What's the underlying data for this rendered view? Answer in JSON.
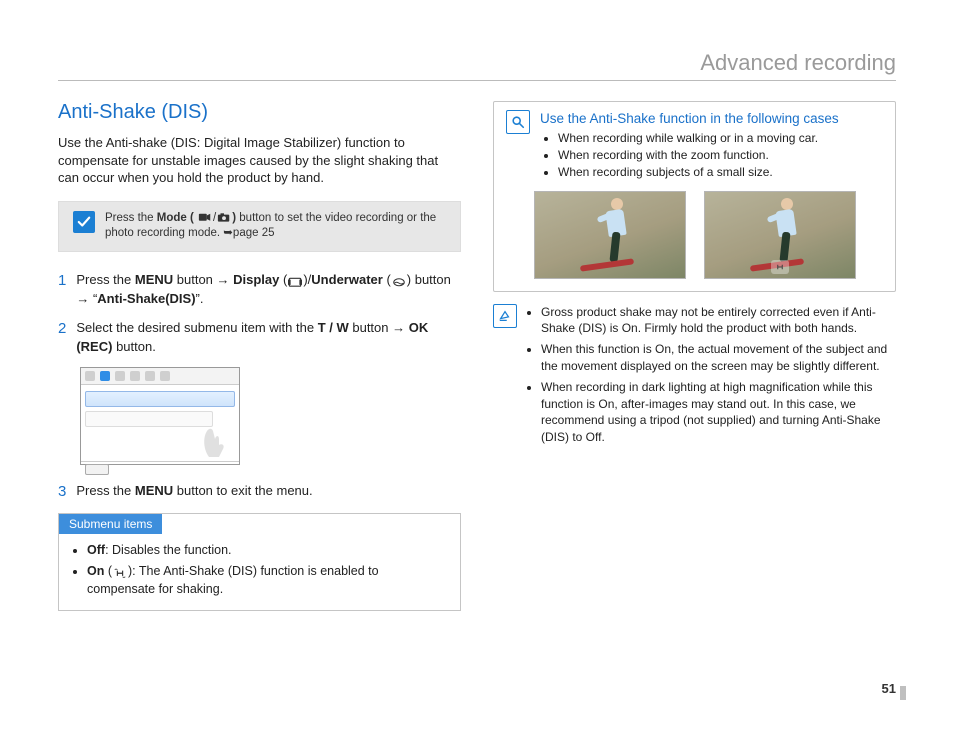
{
  "header": {
    "title": "Advanced recording"
  },
  "left": {
    "title": "Anti-Shake (DIS)",
    "intro": "Use the Anti-shake (DIS: Digital Image Stabilizer) function to compensate for unstable images caused by the slight shaking that can occur when you hold the product by hand.",
    "modebox": {
      "pre": "Press the ",
      "mode_label": "Mode (",
      "post_icons": ")",
      "after": " button to set the video recording or the photo recording mode. ",
      "ref": "➥page 25"
    },
    "steps": [
      {
        "n": "1",
        "pre": "Press the ",
        "menu": "MENU",
        "a1": " button → ",
        "disp": "Display",
        "a2": " (",
        "a3": ")/",
        "uw": "Underwater",
        "a4": " (",
        "a5": ") button → “",
        "target": "Anti-Shake(DIS)",
        "a6": "”."
      },
      {
        "n": "2",
        "pre": "Select the desired submenu item with the ",
        "tw": "T / W",
        "mid": " button → ",
        "ok": "OK (REC)",
        "post": " button."
      },
      {
        "n": "3",
        "pre": "Press the ",
        "menu": "MENU",
        "post": " button to exit the menu."
      }
    ],
    "sub": {
      "head": "Submenu items",
      "off_b": "Off",
      "off_t": ": Disables the function.",
      "on_b": "On",
      "on_t1": " (",
      "on_t2": "): The Anti-Shake (DIS) function is enabled to compensate for shaking."
    }
  },
  "right": {
    "tip_head": "Use the Anti-Shake function in the following cases",
    "cases": [
      "When recording while walking or in a moving car.",
      "When recording with the zoom function.",
      "When recording subjects of a small size."
    ],
    "notes": [
      "Gross product shake may not be entirely corrected even if Anti-Shake (DIS) is On. Firmly hold the product with both hands.",
      "When this function is On, the actual movement of the subject and the movement displayed on the screen may be slightly different.",
      "When recording in dark lighting at high magnification while this function is On, after-images may stand out. In this case, we recommend using a tripod (not supplied) and turning Anti-Shake (DIS) to Off."
    ]
  },
  "page_number": "51"
}
